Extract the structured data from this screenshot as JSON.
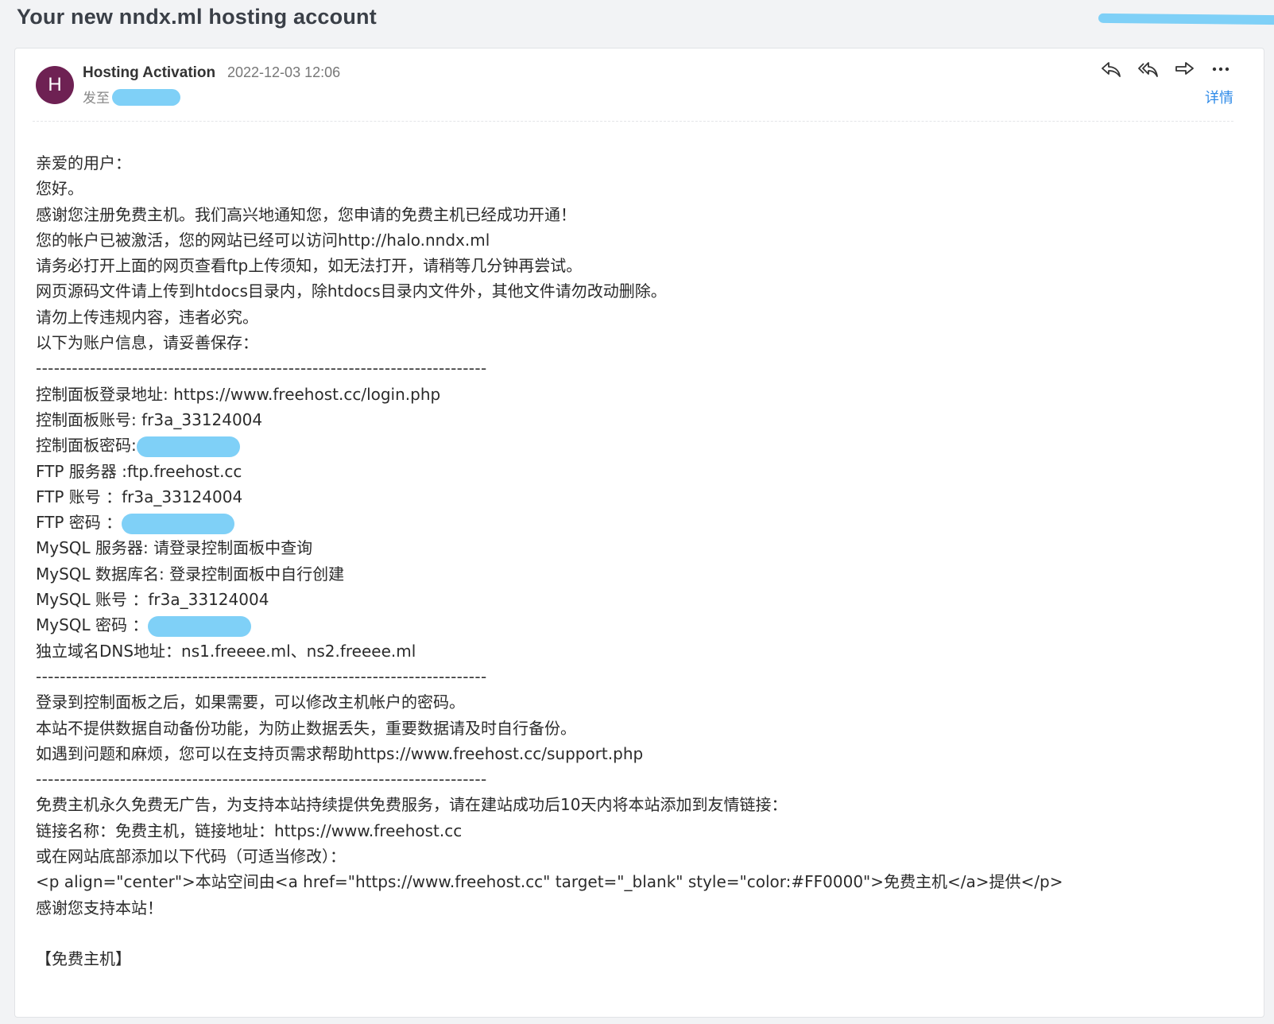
{
  "subject": "Your new nndx.ml hosting account",
  "header": {
    "avatar_letter": "H",
    "sender": "Hosting Activation",
    "date": "2022-12-03 12:06",
    "to_label": "发至",
    "details_label": "详情",
    "actions": [
      "reply-icon",
      "reply-all-icon",
      "forward-icon",
      "more-icon"
    ]
  },
  "body": {
    "greeting": "亲爱的用户：",
    "hello": "您好。",
    "p1": "感谢您注册免费主机。我们高兴地通知您，您申请的免费主机已经成功开通！",
    "p2": "您的帐户已被激活，您的网站已经可以访问http://halo.nndx.ml",
    "p3": "请务必打开上面的网页查看ftp上传须知，如无法打开，请稍等几分钟再尝试。",
    "p4": "网页源码文件请上传到htdocs目录内，除htdocs目录内文件外，其他文件请勿改动删除。",
    "p5": "请勿上传违规内容，违者必究。",
    "p6": "以下为账户信息，请妥善保存：",
    "separator": "---------------------------------------------------------------------------",
    "cp_login_url": "控制面板登录地址: https://www.freehost.cc/login.php",
    "cp_account": "控制面板账号: fr3a_33124004",
    "cp_password_label": "控制面板密码:",
    "ftp_server": "FTP 服务器 :ftp.freehost.cc",
    "ftp_account": "FTP 账号 ：fr3a_33124004",
    "ftp_password_label": "FTP 密码 ：",
    "mysql_server": "MySQL 服务器: 请登录控制面板中查询",
    "mysql_db": "MySQL 数据库名: 登录控制面板中自行创建",
    "mysql_account": "MySQL 账号 ：fr3a_33124004",
    "mysql_password_label": "MySQL 密码 ：",
    "dns": "独立域名DNS地址：ns1.freeee.ml、ns2.freeee.ml",
    "after1": "登录到控制面板之后，如果需要，可以修改主机帐户的密码。",
    "after2": "本站不提供数据自动备份功能，为防止数据丢失，重要数据请及时自行备份。",
    "after3": "如遇到问题和麻烦，您可以在支持页需求帮助https://www.freehost.cc/support.php",
    "ad1": "免费主机永久免费无广告，为支持本站持续提供免费服务，请在建站成功后10天内将本站添加到友情链接：",
    "ad2": "链接名称：免费主机，链接地址：https://www.freehost.cc",
    "ad3": "或在网站底部添加以下代码（可适当修改）：",
    "code": "<p align=\"center\">本站空间由<a href=\"https://www.freehost.cc\" target=\"_blank\" style=\"color:#FF0000\">免费主机</a>提供</p>",
    "thanks": "感谢您支持本站！",
    "signature": "【免费主机】"
  },
  "colors": {
    "avatar_bg": "#6e2153",
    "link_blue": "#2f8be8",
    "redaction": "#7fd0f7"
  }
}
